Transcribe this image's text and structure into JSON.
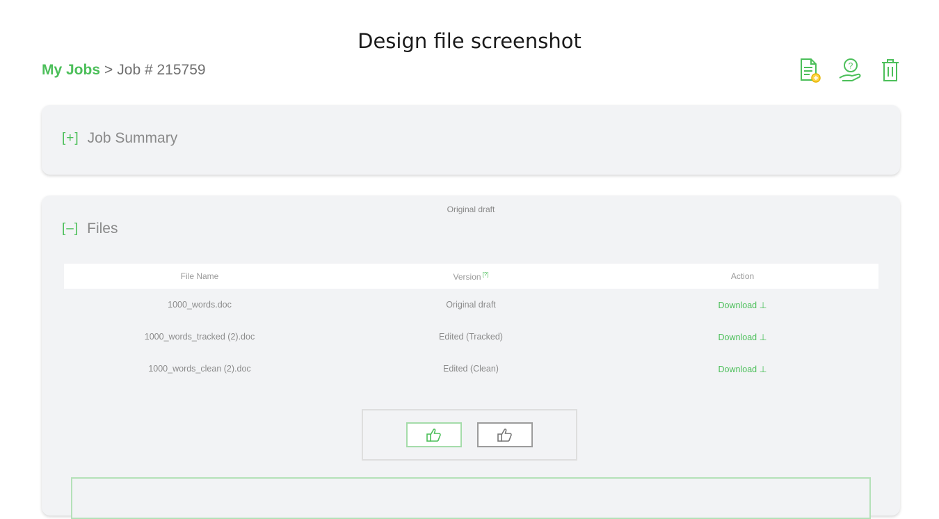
{
  "caption": "Design file screenshot",
  "breadcrumb": {
    "root": "My Jobs",
    "separator": ">",
    "current": "Job # 215759"
  },
  "header_icons": [
    "document-edit-icon",
    "support-hand-icon",
    "trash-icon"
  ],
  "summary_panel": {
    "toggle": "[+]",
    "title": "Job Summary"
  },
  "files_panel": {
    "toggle": "[–]",
    "title": "Files",
    "version_caption": "Original draft",
    "columns": {
      "name": "File Name",
      "version": "Version",
      "version_note": "[?]",
      "action": "Action"
    },
    "rows": [
      {
        "name": "1000_words.doc",
        "version": "Original draft",
        "action": "Download ⊥"
      },
      {
        "name": "1000_words_tracked (2).doc",
        "version": "Edited (Tracked)",
        "action": "Download ⊥"
      },
      {
        "name": "1000_words_clean (2).doc",
        "version": "Edited (Clean)",
        "action": "Download ⊥"
      }
    ]
  },
  "feedback": {
    "icons": [
      "thumbs-up-icon",
      "thumbs-down-icon"
    ]
  },
  "colors": {
    "accent": "#4cbf5a",
    "panel_bg": "#f2f3f5",
    "text_muted": "#8a8a8a"
  }
}
